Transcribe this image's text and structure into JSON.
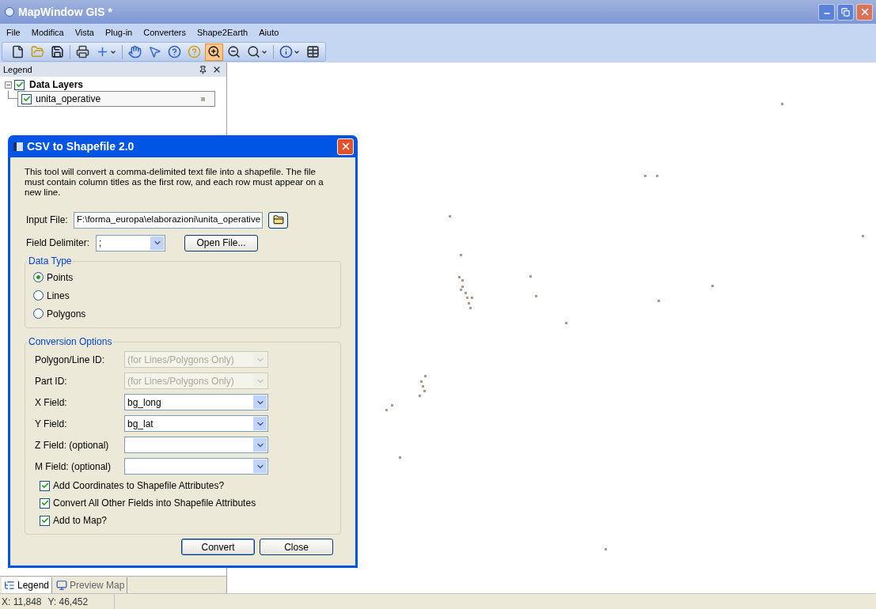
{
  "window": {
    "title": "MapWindow GIS *"
  },
  "menu": [
    "File",
    "Modifica",
    "Vista",
    "Plug-in",
    "Converters",
    "Shape2Earth",
    "Aiuto"
  ],
  "toolbar": [
    {
      "selected": false,
      "dropdown": false
    },
    {
      "selected": false,
      "dropdown": false
    },
    {
      "selected": false,
      "dropdown": false
    },
    {
      "selected": false,
      "dropdown": false
    },
    {
      "selected": false,
      "dropdown": true
    },
    {
      "selected": false,
      "dropdown": false
    },
    {
      "selected": false,
      "dropdown": false
    },
    {
      "selected": false,
      "dropdown": false
    },
    {
      "selected": false,
      "dropdown": false
    },
    {
      "selected": true,
      "dropdown": false
    },
    {
      "selected": false,
      "dropdown": false
    },
    {
      "selected": false,
      "dropdown": true
    },
    {
      "selected": false,
      "dropdown": true
    },
    {
      "selected": false,
      "dropdown": false
    }
  ],
  "legend": {
    "title": "Legend",
    "layers": [
      {
        "label": "Data Layers",
        "checked": true,
        "expanded": true,
        "selected": false,
        "children": [
          {
            "label": "unita_operative",
            "checked": true,
            "selected": true,
            "color": "#b8a898"
          }
        ]
      }
    ]
  },
  "dialog": {
    "title": "CSV to Shapefile 2.0",
    "description": "This tool will convert a comma-delimited text file into a shapefile. The file must contain column titles as the first row, and each row must appear on a new line.",
    "input_file": {
      "label": "Input File:",
      "value": "F:\\forma_europa\\elaborazioni\\unita_operative"
    },
    "field_delimiter": {
      "label": "Field Delimiter:",
      "value": ";"
    },
    "open_file_button": "Open File...",
    "data_type": {
      "title": "Data Type",
      "options": [
        {
          "label": "Points",
          "selected": true
        },
        {
          "label": "Lines",
          "selected": false
        },
        {
          "label": "Polygons",
          "selected": false
        }
      ]
    },
    "conversion_options": {
      "title": "Conversion Options",
      "fields": [
        {
          "label": "Polygon/Line ID:",
          "value": "(for Lines/Polygons Only)",
          "disabled": true
        },
        {
          "label": "Part ID:",
          "value": "(for Lines/Polygons Only)",
          "disabled": true
        },
        {
          "label": "X Field:",
          "value": "bg_long",
          "disabled": false
        },
        {
          "label": "Y Field:",
          "value": "bg_lat",
          "disabled": false
        },
        {
          "label": "Z Field: (optional)",
          "disabled": false
        },
        {
          "label": "M Field: (optional)",
          "disabled": false
        }
      ],
      "checkboxes": [
        {
          "label": "Add Coordinates to Shapefile Attributes?",
          "checked": true
        },
        {
          "label": "Convert All Other Fields into Shapefile Attributes",
          "checked": true
        },
        {
          "label": "Add to Map?",
          "checked": true
        }
      ]
    },
    "buttons": [
      {
        "label": "Convert",
        "default": true
      },
      {
        "label": "Close",
        "default": false
      }
    ]
  },
  "bottom_tabs": [
    {
      "label": "Legend",
      "selected": true
    },
    {
      "label": "Preview Map",
      "selected": false
    }
  ],
  "status_bar": {
    "x": "X: 11,848",
    "y": "Y: 46,452"
  }
}
